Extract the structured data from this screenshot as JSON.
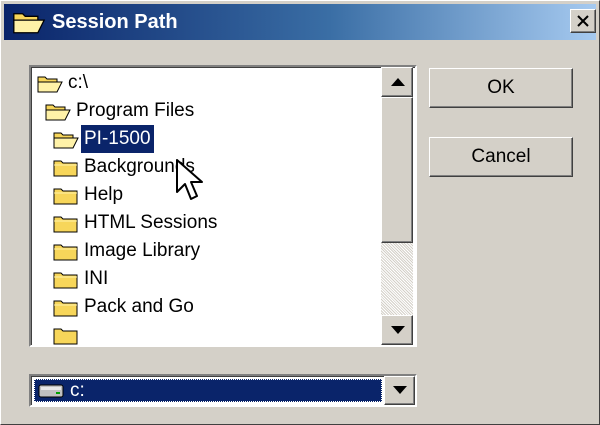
{
  "window": {
    "title": "Session Path",
    "title_icon": "open-folder-icon",
    "close_icon": "close-icon"
  },
  "tree": {
    "items": [
      {
        "label": "c:\\",
        "icon": "open-folder-icon",
        "selected": false
      },
      {
        "label": "Program Files",
        "icon": "open-folder-icon",
        "selected": false
      },
      {
        "label": "PI-1500",
        "icon": "open-folder-icon",
        "selected": true
      },
      {
        "label": "Backgrounds",
        "icon": "folder-icon",
        "selected": false
      },
      {
        "label": "Help",
        "icon": "folder-icon",
        "selected": false
      },
      {
        "label": "HTML Sessions",
        "icon": "folder-icon",
        "selected": false
      },
      {
        "label": "Image Library",
        "icon": "folder-icon",
        "selected": false
      },
      {
        "label": "INI",
        "icon": "folder-icon",
        "selected": false
      },
      {
        "label": "Pack and Go",
        "icon": "folder-icon",
        "selected": false
      }
    ]
  },
  "buttons": {
    "ok_label": "OK",
    "cancel_label": "Cancel"
  },
  "drive": {
    "selected_value": "c:",
    "icon": "drive-icon"
  },
  "colors": {
    "selection": "#0a246a",
    "face": "#d4d0c8",
    "folder": "#f7d65a"
  }
}
